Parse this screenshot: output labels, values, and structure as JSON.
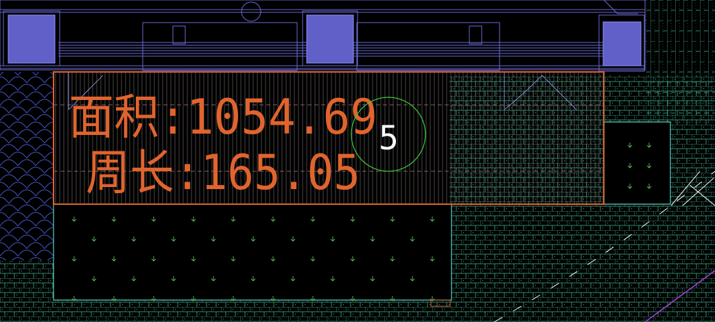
{
  "drawing": {
    "background": "#000000",
    "annotation": {
      "area_label": "面积:1054.69",
      "perimeter_label": "周长:165.05",
      "color": "#e0642e"
    },
    "marker": {
      "label": "5",
      "ring_color": "#3ccf3c",
      "text_color": "#ffffff"
    },
    "colors": {
      "selection_outline": "#e0642e",
      "building_lines": "#6a6ad8",
      "building_fill": "#6060c8",
      "paving_lines": "#3fae8c",
      "lawn_outline": "#5cd6c8",
      "lawn_symbol": "#5cc85c",
      "tile_lines": "#4a56c8",
      "road_dash": "#ffffff",
      "property_line": "#b040e0"
    }
  }
}
